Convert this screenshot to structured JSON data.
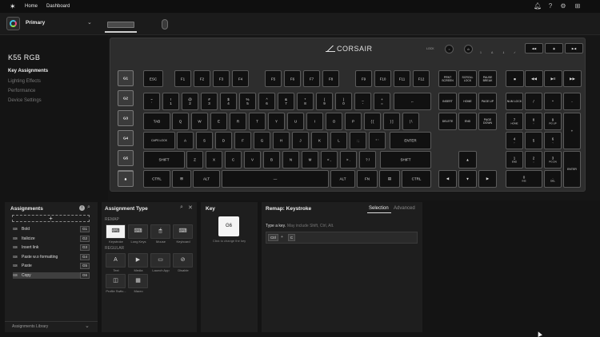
{
  "topbar": {
    "logo_icon": "corsair-logo-icon",
    "nav": [
      "Home",
      "Dashboard"
    ],
    "icons": [
      "bell-icon",
      "help-icon",
      "gear-icon",
      "grid-icon"
    ]
  },
  "profile": {
    "name": "Primary",
    "icon": "profile-ring-icon"
  },
  "device": {
    "title": "K55 RGB",
    "menu": [
      "Key Assignments",
      "Lighting Effects",
      "Performance",
      "Device Settings"
    ],
    "brand": "CORSAIR"
  },
  "keyboard": {
    "gkeys": [
      "G1",
      "G2",
      "G3",
      "G4",
      "G5",
      "G6"
    ],
    "esc": "ESC",
    "fkeys": [
      "F1",
      "F2",
      "F3",
      "F4",
      "F5",
      "F6",
      "F7",
      "F8",
      "F9",
      "F10",
      "F11",
      "F12"
    ],
    "nav_top": [
      "PRNT SCREEN",
      "SCROLL LOCK",
      "PAUSE BREAK"
    ],
    "num_row": [
      {
        "t": "~",
        "b": "`"
      },
      {
        "t": "!",
        "b": "1"
      },
      {
        "t": "@",
        "b": "2"
      },
      {
        "t": "#",
        "b": "3"
      },
      {
        "t": "$",
        "b": "4"
      },
      {
        "t": "%",
        "b": "5"
      },
      {
        "t": "^",
        "b": "6"
      },
      {
        "t": "&",
        "b": "7"
      },
      {
        "t": "*",
        "b": "8"
      },
      {
        "t": "(",
        "b": "9"
      },
      {
        "t": ")",
        "b": "0"
      },
      {
        "t": "_",
        "b": "-"
      },
      {
        "t": "+",
        "b": "="
      }
    ],
    "backspace": "←",
    "nav_mid": [
      "INSERT",
      "HOME",
      "PAGE UP",
      "DELETE",
      "END",
      "PAGE DOWN"
    ],
    "numpad_top": [
      "NUM LOCK",
      "/",
      "*",
      "-"
    ],
    "tab": "TAB",
    "qwerty": [
      "Q",
      "W",
      "E",
      "R",
      "T",
      "Y",
      "U",
      "I",
      "O",
      "P",
      "{ [",
      "} ]",
      "| \\"
    ],
    "caps": "CAPS LOCK",
    "asdf": [
      "A",
      "S",
      "D",
      "F",
      "G",
      "H",
      "J",
      "K",
      "L",
      ": ;",
      "\" '"
    ],
    "enter": "ENTER",
    "shift": "SHIFT",
    "zxcv": [
      "Z",
      "X",
      "C",
      "V",
      "B",
      "N",
      "M",
      "< ,",
      "> .",
      "? /"
    ],
    "ctrl": "CTRL",
    "alt": "ALT",
    "fn": "FN",
    "win_icon": "windows-icon",
    "menu_icon": "menu-icon",
    "lock_icon": "lock-icon",
    "arrows": [
      "▲",
      "◀",
      "▼",
      "▶"
    ],
    "numpad": [
      {
        "t": "7",
        "b": "HOME"
      },
      {
        "t": "8",
        "b": "↑"
      },
      {
        "t": "9",
        "b": "PG UP"
      },
      {
        "t": "4",
        "b": "←"
      },
      {
        "t": "5",
        "b": ""
      },
      {
        "t": "6",
        "b": "→"
      },
      {
        "t": "1",
        "b": "END"
      },
      {
        "t": "2",
        "b": "↓"
      },
      {
        "t": "3",
        "b": "PG DN"
      },
      {
        "t": "0",
        "b": "INS"
      },
      {
        "t": ".",
        "b": "DEL"
      }
    ],
    "num_plus": "+",
    "num_enter": "ENTER",
    "media_top": [
      "◀◀",
      "◉",
      "▶◀"
    ],
    "media_row": [
      "■",
      "◀◀",
      "▶II",
      "▶▶"
    ],
    "indicators": {
      "lock": "LOCK",
      "dots": [
        "1",
        "A",
        "⇓",
        "✓"
      ]
    }
  },
  "assignments": {
    "title": "Assignments",
    "add_icon": "plus-icon",
    "items": [
      {
        "name": "Bold",
        "key": "G1"
      },
      {
        "name": "Italicize",
        "key": "G2"
      },
      {
        "name": "Insert link",
        "key": "G3"
      },
      {
        "name": "Paste w.o formatting",
        "key": "G4"
      },
      {
        "name": "Paste",
        "key": "G5"
      },
      {
        "name": "Copy",
        "key": "G6"
      }
    ],
    "library": "Assignments Library"
  },
  "assignment_type": {
    "title": "Assignment Type",
    "remap_label": "REMAP",
    "remap": [
      "Keystroke",
      "Long Keys",
      "Mouse",
      "Keyboard"
    ],
    "regular_label": "REGULAR",
    "regular": [
      "Text",
      "Media",
      "Launch App",
      "Disable",
      "Profile Switc...",
      "Macro"
    ]
  },
  "key": {
    "title": "Key",
    "value": "G6",
    "hint": "Click to change the key"
  },
  "remap": {
    "title": "Remap: Keystroke",
    "tabs": [
      "Selection",
      "Advanced"
    ],
    "prompt": "Type a key.",
    "prompt_hint": "May include Shift, Ctrl, Alt.",
    "combo": [
      "Ctrl",
      "+",
      "C"
    ]
  }
}
